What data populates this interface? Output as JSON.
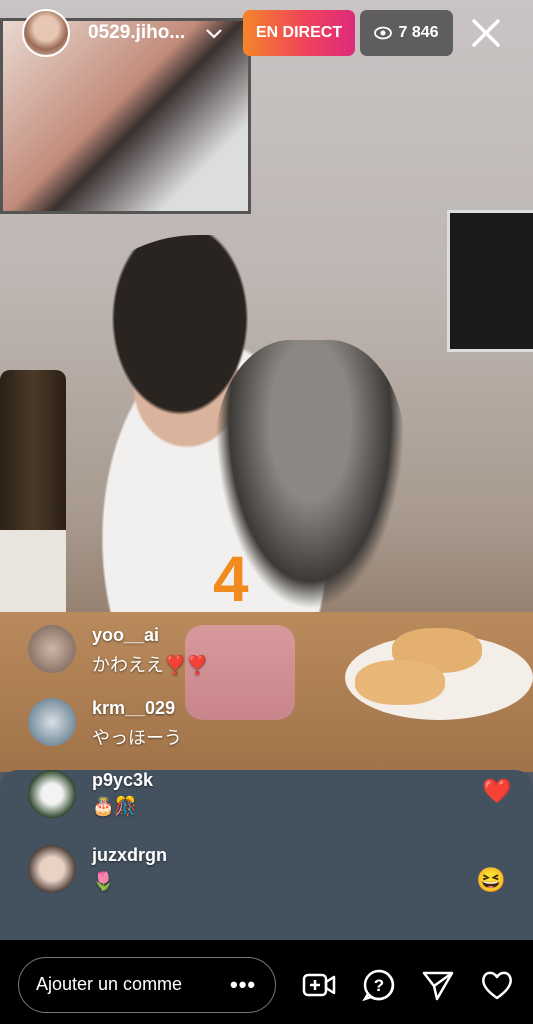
{
  "header": {
    "username": "0529.jiho...",
    "live_label": "EN DIRECT",
    "viewer_count": "7 846",
    "icons": [
      "chevron-down-icon",
      "eye-icon",
      "close-icon"
    ],
    "colors": {
      "live_gradient_start": "#f58529",
      "live_gradient_end": "#dd2a7b"
    }
  },
  "comments": [
    {
      "user": "yoo__ai",
      "text": "かわええ❣️❣️"
    },
    {
      "user": "krm__029",
      "text": "やっほーう"
    },
    {
      "user": "p9yc3k",
      "text": "🎂🎊"
    },
    {
      "user": "juzxdrgn",
      "text": "🌷"
    }
  ],
  "reactions": [
    "❤️",
    "😆"
  ],
  "scene": {
    "candle_number": "4"
  },
  "bottom_bar": {
    "comment_placeholder": "Ajouter un comme",
    "more_label": "•••",
    "icons": [
      "add-guest-video-icon",
      "question-icon",
      "send-icon",
      "heart-icon"
    ]
  }
}
